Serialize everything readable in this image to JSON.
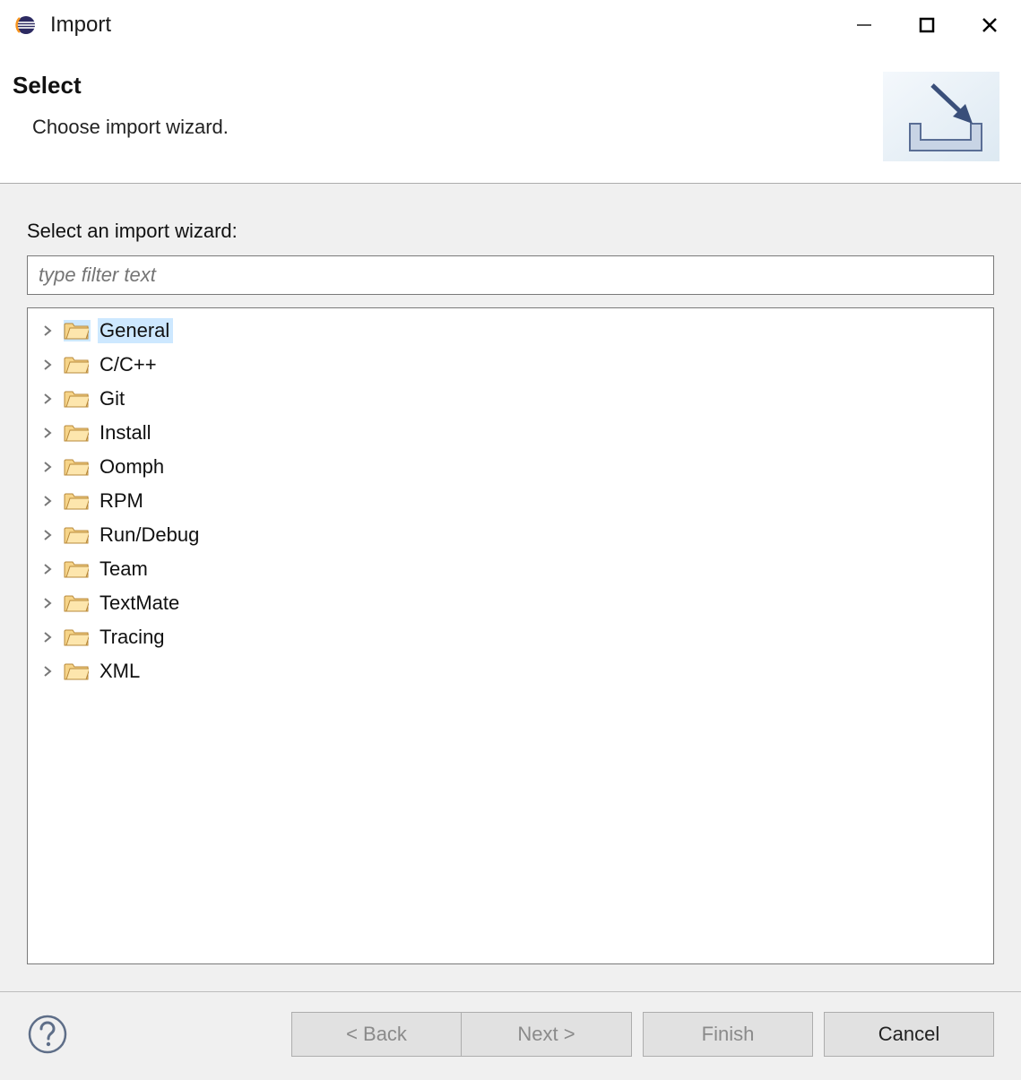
{
  "window": {
    "title": "Import"
  },
  "banner": {
    "heading": "Select",
    "subtext": "Choose import wizard."
  },
  "content": {
    "label": "Select an import wizard:",
    "filter_placeholder": "type filter text"
  },
  "tree": {
    "items": [
      {
        "label": "General",
        "selected": true
      },
      {
        "label": "C/C++",
        "selected": false
      },
      {
        "label": "Git",
        "selected": false
      },
      {
        "label": "Install",
        "selected": false
      },
      {
        "label": "Oomph",
        "selected": false
      },
      {
        "label": "RPM",
        "selected": false
      },
      {
        "label": "Run/Debug",
        "selected": false
      },
      {
        "label": "Team",
        "selected": false
      },
      {
        "label": "TextMate",
        "selected": false
      },
      {
        "label": "Tracing",
        "selected": false
      },
      {
        "label": "XML",
        "selected": false
      }
    ]
  },
  "footer": {
    "back": "< Back",
    "next": "Next >",
    "finish": "Finish",
    "cancel": "Cancel",
    "back_enabled": false,
    "next_enabled": false,
    "finish_enabled": false,
    "cancel_enabled": true
  }
}
